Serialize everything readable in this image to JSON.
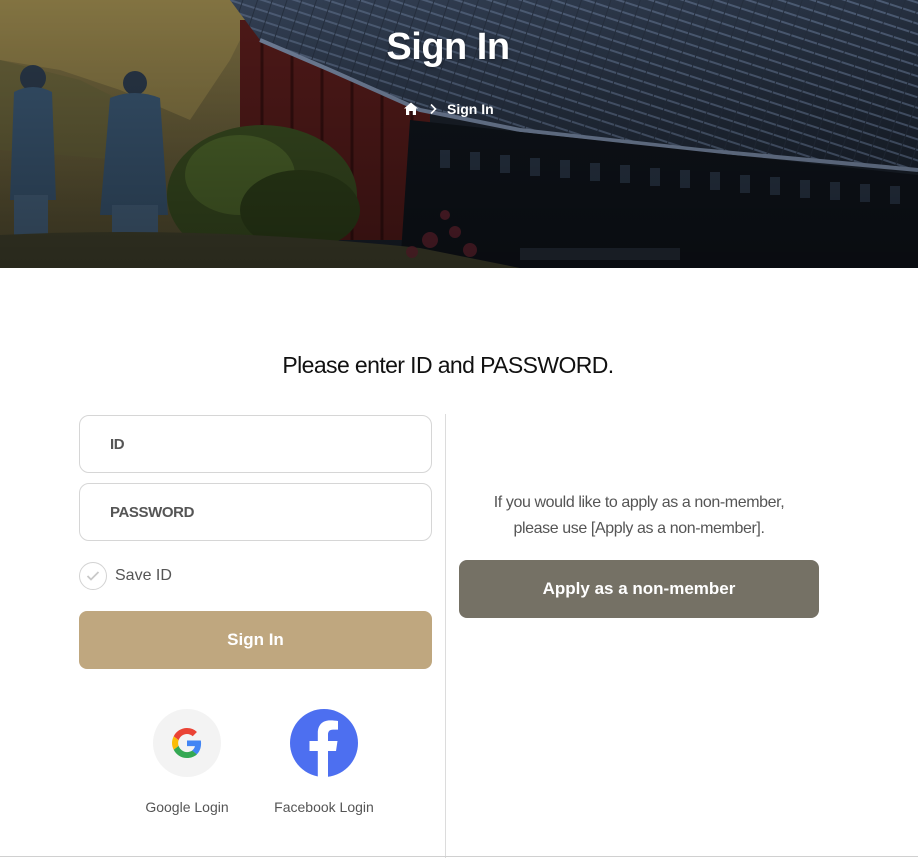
{
  "hero": {
    "title": "Sign In",
    "breadcrumb": {
      "home_icon": "home-icon",
      "separator_icon": "chevron-right-icon",
      "current": "Sign In"
    }
  },
  "login": {
    "heading": "Please enter ID and PASSWORD.",
    "id_placeholder": "ID",
    "password_placeholder": "PASSWORD",
    "save_id_label": "Save ID",
    "save_id_checked": false,
    "signin_label": "Sign In",
    "google_label": "Google Login",
    "facebook_label": "Facebook Login"
  },
  "nonmember": {
    "text_line1": "If you would like to apply as a non-member,",
    "text_line2": "please use [Apply as a non-member].",
    "button_label": "Apply as a non-member"
  },
  "colors": {
    "signin_button": "#bfa77f",
    "nonmember_button": "#757165",
    "facebook_blue": "#4d6ff0",
    "google_circle_bg": "#f3f3f3"
  },
  "icons": [
    "home-icon",
    "chevron-right-icon",
    "check-icon",
    "google-icon",
    "facebook-icon"
  ]
}
